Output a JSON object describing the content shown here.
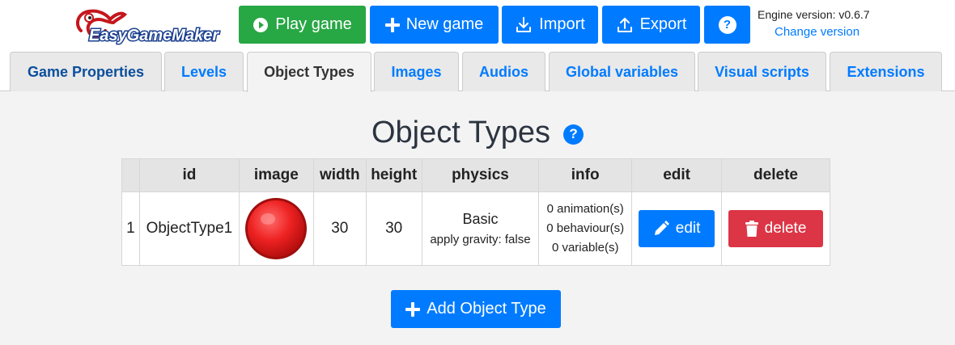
{
  "app": {
    "logo_text": "EasyGameMaker",
    "accent": "#007bff",
    "success": "#28a745",
    "danger": "#dc3545"
  },
  "toolbar": {
    "play_label": "Play game",
    "new_label": "New game",
    "import_label": "Import",
    "export_label": "Export",
    "help_label": "?",
    "engine_version": "Engine version: v0.6.7",
    "change_version": "Change version"
  },
  "tabs": [
    {
      "label": "Game Properties"
    },
    {
      "label": "Levels"
    },
    {
      "label": "Object Types",
      "active": true
    },
    {
      "label": "Images"
    },
    {
      "label": "Audios"
    },
    {
      "label": "Global variables"
    },
    {
      "label": "Visual scripts"
    },
    {
      "label": "Extensions"
    }
  ],
  "main": {
    "title": "Object Types",
    "help_label": "?",
    "columns": [
      "",
      "id",
      "image",
      "width",
      "height",
      "physics",
      "info",
      "edit",
      "delete"
    ],
    "rows": [
      {
        "num": "1",
        "id": "ObjectType1",
        "image_icon": "red-ball-image",
        "width": "30",
        "height": "30",
        "physics_main": "Basic",
        "physics_sub": "apply gravity: false",
        "info": [
          "0 animation(s)",
          "0 behaviour(s)",
          "0 variable(s)"
        ],
        "edit_label": "edit",
        "delete_label": "delete"
      }
    ],
    "add_label": "Add Object Type"
  }
}
